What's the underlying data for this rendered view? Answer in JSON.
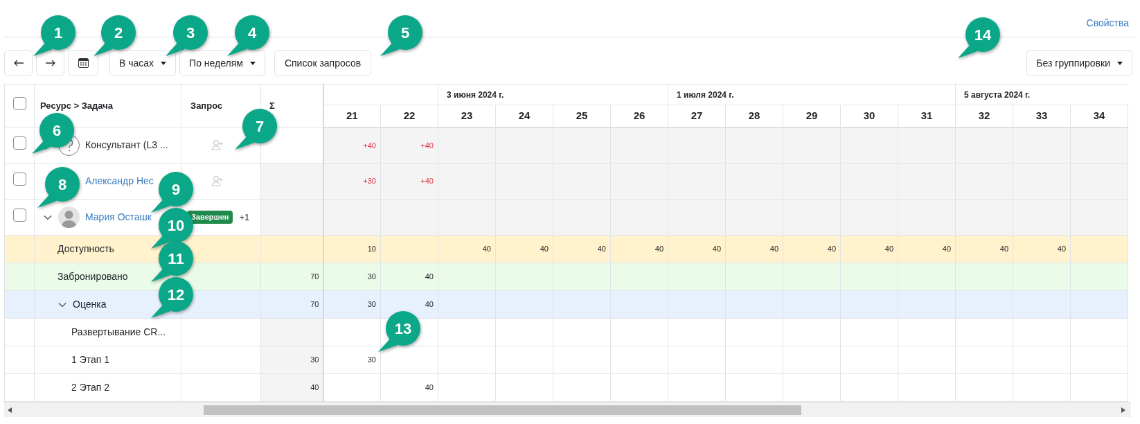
{
  "header": {
    "properties_link": "Свойства"
  },
  "toolbar": {
    "dropdowns": [
      "В часах",
      "По неделям"
    ],
    "requests_button": "Список запросов",
    "grouping_dropdown": "Без группировки"
  },
  "table": {
    "columns": [
      "Ресурс > Задача",
      "Запрос",
      "Σ"
    ],
    "header_checked": false,
    "months": [
      {
        "weeks": [
          "21",
          "22"
        ]
      },
      {
        "label": "3 июня 2024 г.",
        "weeks": [
          "23",
          "24",
          "25",
          "26"
        ]
      },
      {
        "label": "1 июля 2024 г.",
        "weeks": [
          "27",
          "28",
          "29",
          "30",
          "31"
        ]
      },
      {
        "label": "5 августа 2024 г.",
        "weeks": [
          "32",
          "33",
          "34"
        ]
      }
    ],
    "rows": [
      {
        "kind": "role",
        "name": "Консультант (L3 ...",
        "link": false,
        "checked": false,
        "expanded": false,
        "add_request": true,
        "cells": [
          {
            "value": "+40"
          },
          {
            "value": "+40"
          }
        ]
      },
      {
        "kind": "resource",
        "name": "Александр Нес",
        "link": true,
        "checked": false,
        "expanded": false,
        "add_request": true,
        "cells": [
          {
            "value": "+30"
          },
          {
            "value": "+40"
          }
        ]
      },
      {
        "kind": "resource",
        "name": "Мария Осташк",
        "link": true,
        "checked": false,
        "expanded": true,
        "add_request": false,
        "status": "Завершен",
        "extra": "+1",
        "children": [
          {
            "kind": "availability",
            "name": "Доступность",
            "cells": [
              {
                "value": "10"
              },
              {},
              {
                "value": "40"
              },
              {
                "value": "40"
              },
              {
                "value": "40"
              },
              {
                "value": "40"
              },
              {
                "value": "40"
              },
              {
                "value": "40"
              },
              {
                "value": "40"
              },
              {
                "value": "40"
              },
              {
                "value": "40"
              },
              {
                "value": "40"
              },
              {
                "value": "40"
              }
            ]
          },
          {
            "kind": "booked",
            "name": "Забронировано",
            "sum": "70",
            "cells": [
              {
                "value": "30"
              },
              {
                "value": "40"
              }
            ]
          },
          {
            "kind": "project",
            "name": "Оценка",
            "expanded": true,
            "sum": "70",
            "cells": [
              {
                "value": "30"
              },
              {
                "value": "40"
              }
            ],
            "children": [
              {
                "kind": "task",
                "name": "Развертывание CR..."
              },
              {
                "kind": "task",
                "name": "1 Этап 1",
                "sum": "30",
                "cells": [
                  {
                    "value": "30"
                  }
                ]
              },
              {
                "kind": "task",
                "name": "2 Этап 2",
                "sum": "40",
                "cells": [
                  {},
                  {
                    "value": "40"
                  }
                ]
              }
            ]
          }
        ]
      }
    ]
  },
  "callouts": [
    "1",
    "2",
    "3",
    "4",
    "5",
    "6",
    "7",
    "8",
    "9",
    "10",
    "11",
    "12",
    "13",
    "14"
  ]
}
